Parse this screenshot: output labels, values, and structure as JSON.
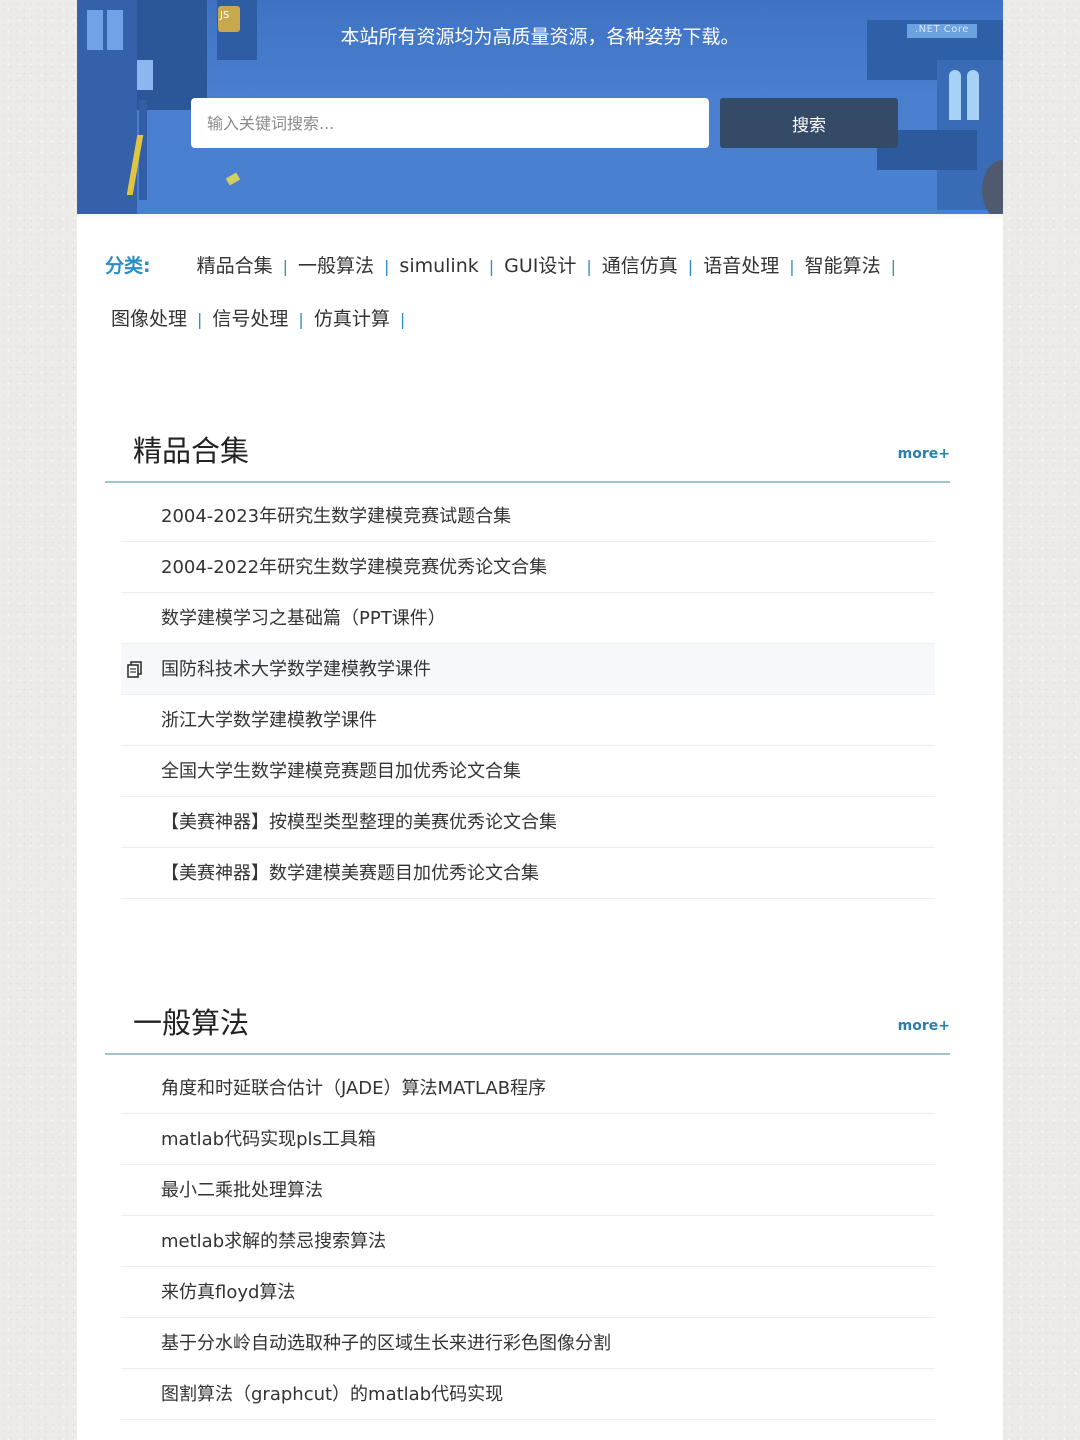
{
  "banner": {
    "tagline": "本站所有资源均为高质量资源，各种姿势下载。",
    "search_placeholder": "输入关键词搜索...",
    "search_button": "搜索",
    "deco_js": "JS",
    "deco_net": ".NET Core"
  },
  "categories": {
    "label": "分类:",
    "items": [
      "精品合集",
      "一般算法",
      "simulink",
      "GUI设计",
      "通信仿真",
      "语音处理",
      "智能算法",
      "图像处理",
      "信号处理",
      "仿真计算"
    ]
  },
  "sections": [
    {
      "title": "精品合集",
      "more": "more+",
      "items": [
        "2004-2023年研究生数学建模竞赛试题合集",
        "2004-2022年研究生数学建模竞赛优秀论文合集",
        "数学建模学习之基础篇（PPT课件）",
        "国防科技术大学数学建模教学课件",
        "浙江大学数学建模教学课件",
        "全国大学生数学建模竞赛题目加优秀论文合集",
        "【美赛神器】按模型类型整理的美赛优秀论文合集",
        "【美赛神器】数学建模美赛题目加优秀论文合集"
      ]
    },
    {
      "title": "一般算法",
      "more": "more+",
      "items": [
        "角度和时延联合估计（JADE）算法MATLAB程序",
        "matlab代码实现pls工具箱",
        "最小二乘批处理算法",
        "metlab求解的禁忌搜索算法",
        "来仿真floyd算法",
        "基于分水岭自动选取种子的区域生长来进行彩色图像分割",
        "图割算法（graphcut）的matlab代码实现"
      ]
    }
  ]
}
